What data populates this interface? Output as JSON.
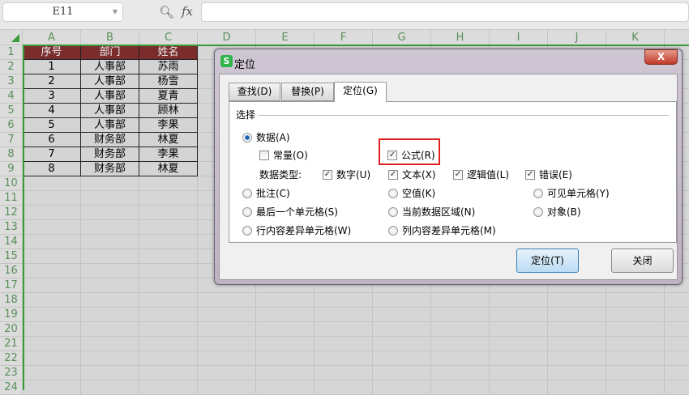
{
  "toolbar": {
    "name_box": "E11",
    "fx": "fx",
    "formula": ""
  },
  "columns": [
    "A",
    "B",
    "C",
    "D",
    "E",
    "F",
    "G",
    "H",
    "I",
    "J",
    "K"
  ],
  "row_count": 24,
  "table": {
    "headers": [
      "序号",
      "部门",
      "姓名"
    ],
    "rows": [
      [
        "1",
        "人事部",
        "苏雨"
      ],
      [
        "2",
        "人事部",
        "杨雪"
      ],
      [
        "3",
        "人事部",
        "夏青"
      ],
      [
        "4",
        "人事部",
        "顾林"
      ],
      [
        "5",
        "人事部",
        "李果"
      ],
      [
        "6",
        "财务部",
        "林夏"
      ],
      [
        "7",
        "财务部",
        "李果"
      ],
      [
        "8",
        "财务部",
        "林夏"
      ]
    ]
  },
  "dialog": {
    "logo": "S",
    "title": "定位",
    "close": "X",
    "tabs": [
      "查找(D)",
      "替换(P)",
      "定位(G)"
    ],
    "group_label": "选择",
    "data": "数据(A)",
    "constant": "常量(O)",
    "formula": "公式(R)",
    "data_type_label": "数据类型:",
    "types": [
      "数字(U)",
      "文本(X)",
      "逻辑值(L)",
      "错误(E)"
    ],
    "options": [
      "批注(C)",
      "空值(K)",
      "可见单元格(Y)",
      "最后一个单元格(S)",
      "当前数据区域(N)",
      "对象(B)",
      "行内容差异单元格(W)",
      "列内容差异单元格(M)"
    ],
    "ok": "定位(T)",
    "close_btn": "关闭"
  }
}
